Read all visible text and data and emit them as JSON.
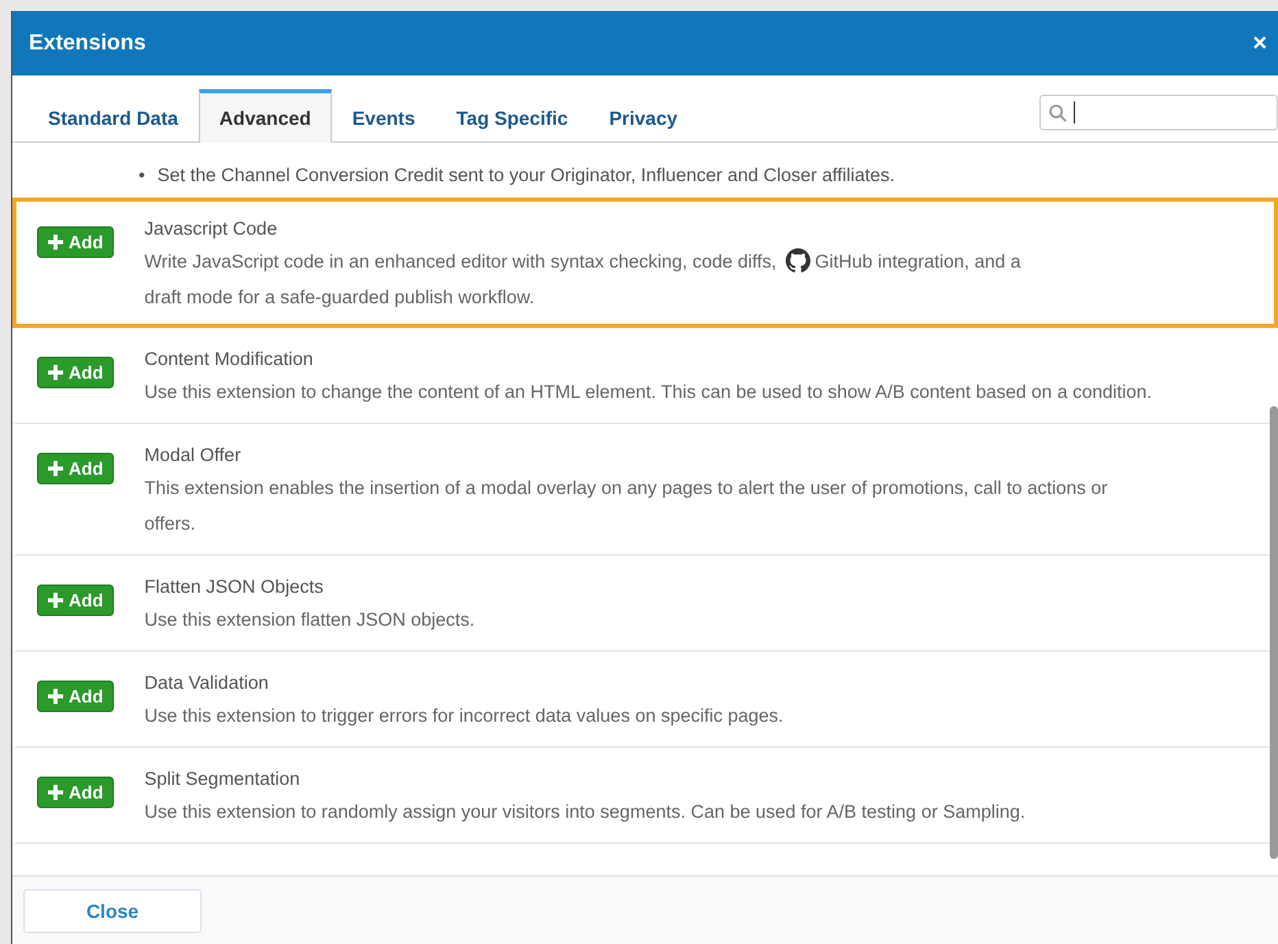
{
  "window": {
    "title": "Extensions",
    "close": "×"
  },
  "tabs": [
    {
      "label": "Standard Data",
      "selected": false
    },
    {
      "label": "Advanced",
      "selected": true
    },
    {
      "label": "Events",
      "selected": false
    },
    {
      "label": "Tag Specific",
      "selected": false
    },
    {
      "label": "Privacy",
      "selected": false
    }
  ],
  "bullets": [
    {
      "marker": "•",
      "text": "Set the Channel Conversion Credit sent to your Originator, Influencer and Closer affiliates."
    }
  ],
  "extensions": [
    {
      "title": "Javascript Code",
      "highlighted": true,
      "button": "Add",
      "description": [
        {
          "kind": "text",
          "text": "Write JavaScript code in an enhanced editor with syntax checking, code diffs,"
        },
        {
          "kind": "icon"
        },
        {
          "kind": "text",
          "text": "GitHub integration, and a"
        },
        {
          "kind": "text",
          "text": "draft mode for a safe-guarded publish workflow."
        }
      ]
    },
    {
      "title": "Content Modification",
      "highlighted": false,
      "button": "Add",
      "description": [
        {
          "kind": "text",
          "text": "Use this extension to change the content of an HTML element. This can be used to show A/B content based on a condition."
        }
      ]
    },
    {
      "title": "Modal Offer",
      "highlighted": false,
      "button": "Add",
      "description": [
        {
          "kind": "text",
          "text": "This extension enables the insertion of a modal overlay on any pages to alert the user of promotions, call to actions or offers."
        }
      ]
    },
    {
      "title": "Flatten JSON Objects",
      "highlighted": false,
      "button": "Add",
      "description": [
        {
          "kind": "text",
          "text": "Use this extension flatten JSON objects."
        }
      ]
    },
    {
      "title": "Data Validation",
      "highlighted": false,
      "button": "Add",
      "description": [
        {
          "kind": "text",
          "text": "Use this extension to trigger errors for incorrect data values on specific pages."
        }
      ]
    },
    {
      "title": "Split Segmentation",
      "highlighted": false,
      "button": "Add",
      "description": [
        {
          "kind": "text",
          "text": "Use this extension to randomly assign your visitors into segments. Can be used for A/B testing or Sampling."
        }
      ]
    }
  ],
  "footer": {
    "button": "Close"
  }
}
